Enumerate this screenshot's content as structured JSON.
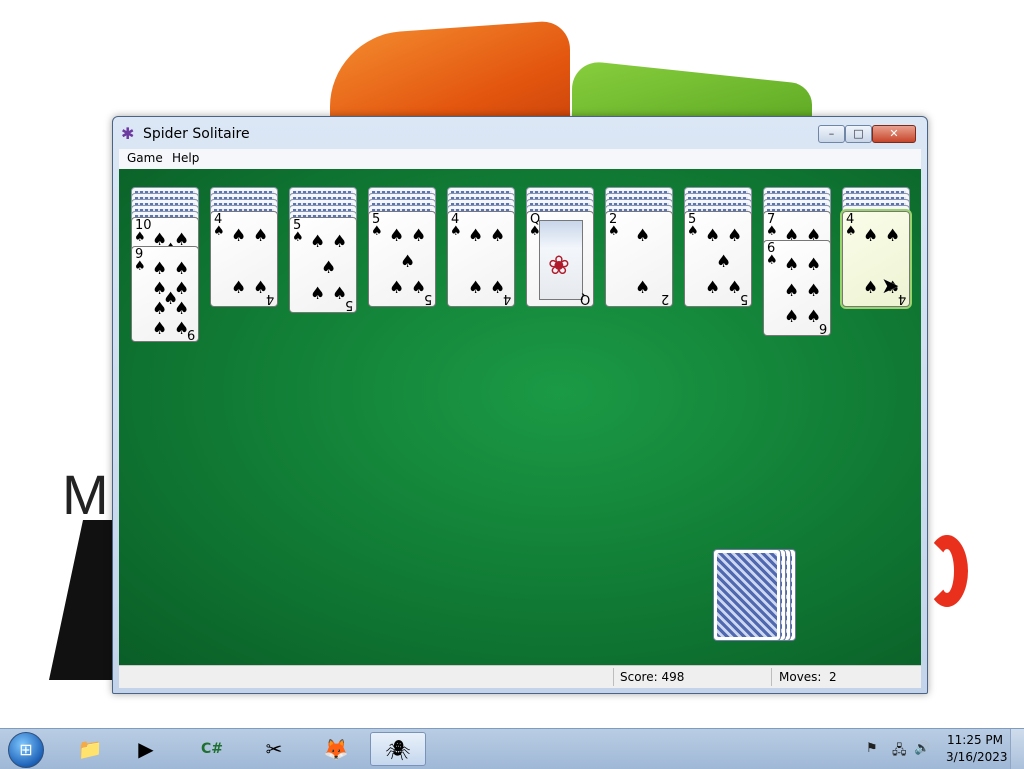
{
  "window": {
    "title": "Spider Solitaire",
    "menu": [
      "Game",
      "Help"
    ],
    "controls": {
      "minimize": "–",
      "maximize": "□",
      "close": "✕"
    }
  },
  "tableau": [
    {
      "face_down": 5,
      "cards": [
        {
          "rank": "10",
          "suit": "♠"
        },
        {
          "rank": "9",
          "suit": "♠"
        }
      ]
    },
    {
      "face_down": 4,
      "cards": [
        {
          "rank": "4",
          "suit": "♠"
        }
      ]
    },
    {
      "face_down": 5,
      "cards": [
        {
          "rank": "5",
          "suit": "♠"
        }
      ]
    },
    {
      "face_down": 4,
      "cards": [
        {
          "rank": "5",
          "suit": "♠"
        }
      ]
    },
    {
      "face_down": 4,
      "cards": [
        {
          "rank": "4",
          "suit": "♠"
        }
      ]
    },
    {
      "face_down": 4,
      "cards": [
        {
          "rank": "Q",
          "suit": "♠"
        }
      ]
    },
    {
      "face_down": 4,
      "cards": [
        {
          "rank": "2",
          "suit": "♠"
        }
      ]
    },
    {
      "face_down": 4,
      "cards": [
        {
          "rank": "5",
          "suit": "♠"
        }
      ]
    },
    {
      "face_down": 4,
      "cards": [
        {
          "rank": "7",
          "suit": "♠"
        },
        {
          "rank": "6",
          "suit": "♠"
        }
      ]
    },
    {
      "face_down": 4,
      "cards": [
        {
          "rank": "4",
          "suit": "♠"
        }
      ],
      "selected": true
    }
  ],
  "stock": {
    "piles": 4
  },
  "status": {
    "score_label": "Score: 498",
    "moves_label": "Moves:",
    "moves_value": "2"
  },
  "taskbar": {
    "start_icon": "windows-orb-icon",
    "apps": [
      {
        "name": "file-explorer-icon",
        "glyph": "📁"
      },
      {
        "name": "media-player-icon",
        "glyph": "▶"
      },
      {
        "name": "csharp-icon",
        "glyph": "C#"
      },
      {
        "name": "snipping-tool-icon",
        "glyph": "✂"
      },
      {
        "name": "firefox-icon",
        "glyph": "🦊"
      },
      {
        "name": "spider-solitaire-icon",
        "glyph": "🕷",
        "active": true
      }
    ],
    "tray": {
      "time": "11:25 PM",
      "date": "3/16/2023"
    }
  }
}
